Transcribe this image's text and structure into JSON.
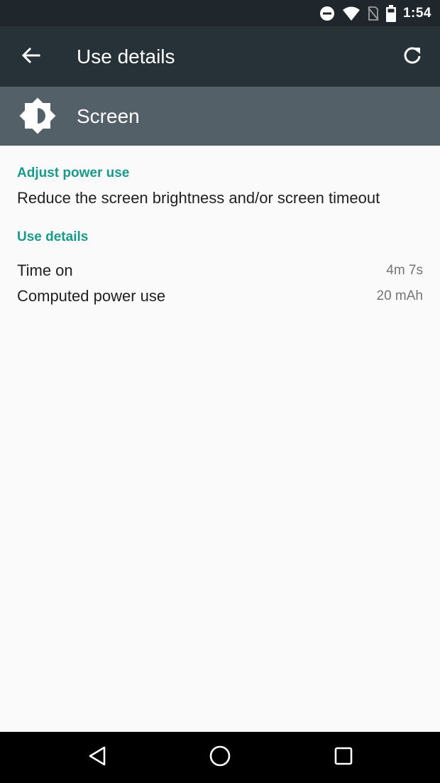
{
  "status_bar": {
    "time": "1:54",
    "icons": [
      "do-not-disturb-icon",
      "wifi-icon",
      "no-sim-icon",
      "battery-icon"
    ]
  },
  "app_bar": {
    "title": "Use details",
    "back_icon": "back-arrow-icon",
    "refresh_icon": "refresh-icon"
  },
  "header": {
    "title": "Screen",
    "icon": "brightness-icon"
  },
  "sections": {
    "adjust": {
      "label": "Adjust power use",
      "text": "Reduce the screen brightness and/or screen timeout"
    },
    "details": {
      "label": "Use details",
      "rows": [
        {
          "label": "Time on",
          "value": "4m 7s"
        },
        {
          "label": "Computed power use",
          "value": "20 mAh"
        }
      ]
    }
  },
  "nav_bar": {
    "buttons": [
      "back-nav-icon",
      "home-nav-icon",
      "recents-nav-icon"
    ]
  },
  "colors": {
    "status_bar": "#1f272d",
    "app_bar": "#263238",
    "header_strip": "#546067",
    "accent": "#1a9a8a",
    "background": "#fafafa"
  }
}
